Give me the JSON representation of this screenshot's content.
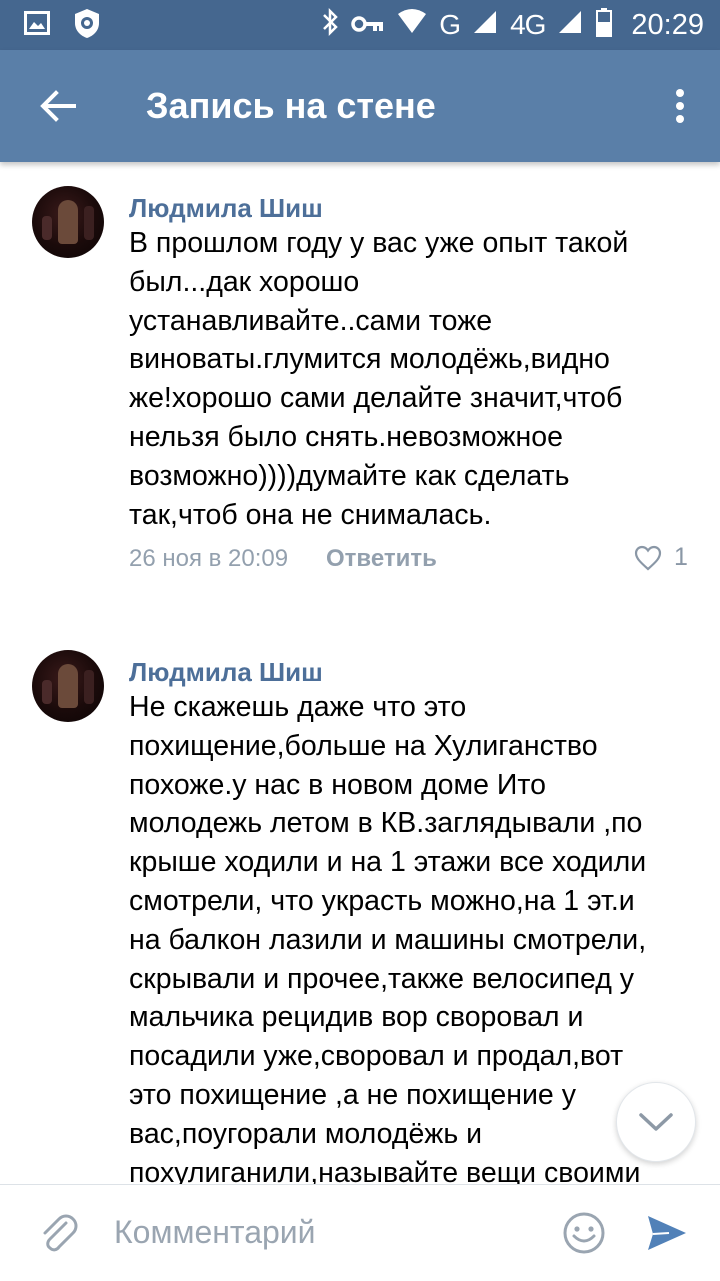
{
  "status_bar": {
    "network_g": "G",
    "network_4g": "4G",
    "time": "20:29"
  },
  "app_bar": {
    "title": "Запись на стене"
  },
  "comments": [
    {
      "author": "Людмила Шиш",
      "text": "В прошлом году у вас уже опыт такой\nбыл...дак хорошо\nустанавливайте..сами тоже\nвиноваты.глумится молодёжь,видно\nже!хорошо сами делайте значит,чтоб\nнельзя было снять.невозможное\nвозможно))))думайте как сделать\nтак,чтоб она не снималась.",
      "date": "26 ноя в 20:09",
      "reply_label": "Ответить",
      "likes": "1"
    },
    {
      "author": "Людмила Шиш",
      "text": "Не скажешь даже что это\nпохищение,больше на Хулиганство\nпохоже.у нас в новом доме Ито\nмолодежь летом в КВ.заглядывали ,по\nкрыше ходили и на 1 этажи все ходили\nсмотрели, что украсть можно,на 1 эт.и\nна балкон лазили и машины смотрели,\nскрывали и прочее,также велосипед у\nмальчика рецидив вор своровал и\nпосадили уже,своровал и продал,вот\nэто похищение ,а не похищение у\nвас,поугорали молодёжь и\nпохулиганили,называйте вещи своими"
    }
  ],
  "input_bar": {
    "placeholder": "Комментарий"
  },
  "colors": {
    "status_bar": "#45678f",
    "app_bar": "#5a7fa8",
    "author_name": "#4d6f99",
    "meta_text": "#93a0ae",
    "send_accent": "#5181b8"
  }
}
